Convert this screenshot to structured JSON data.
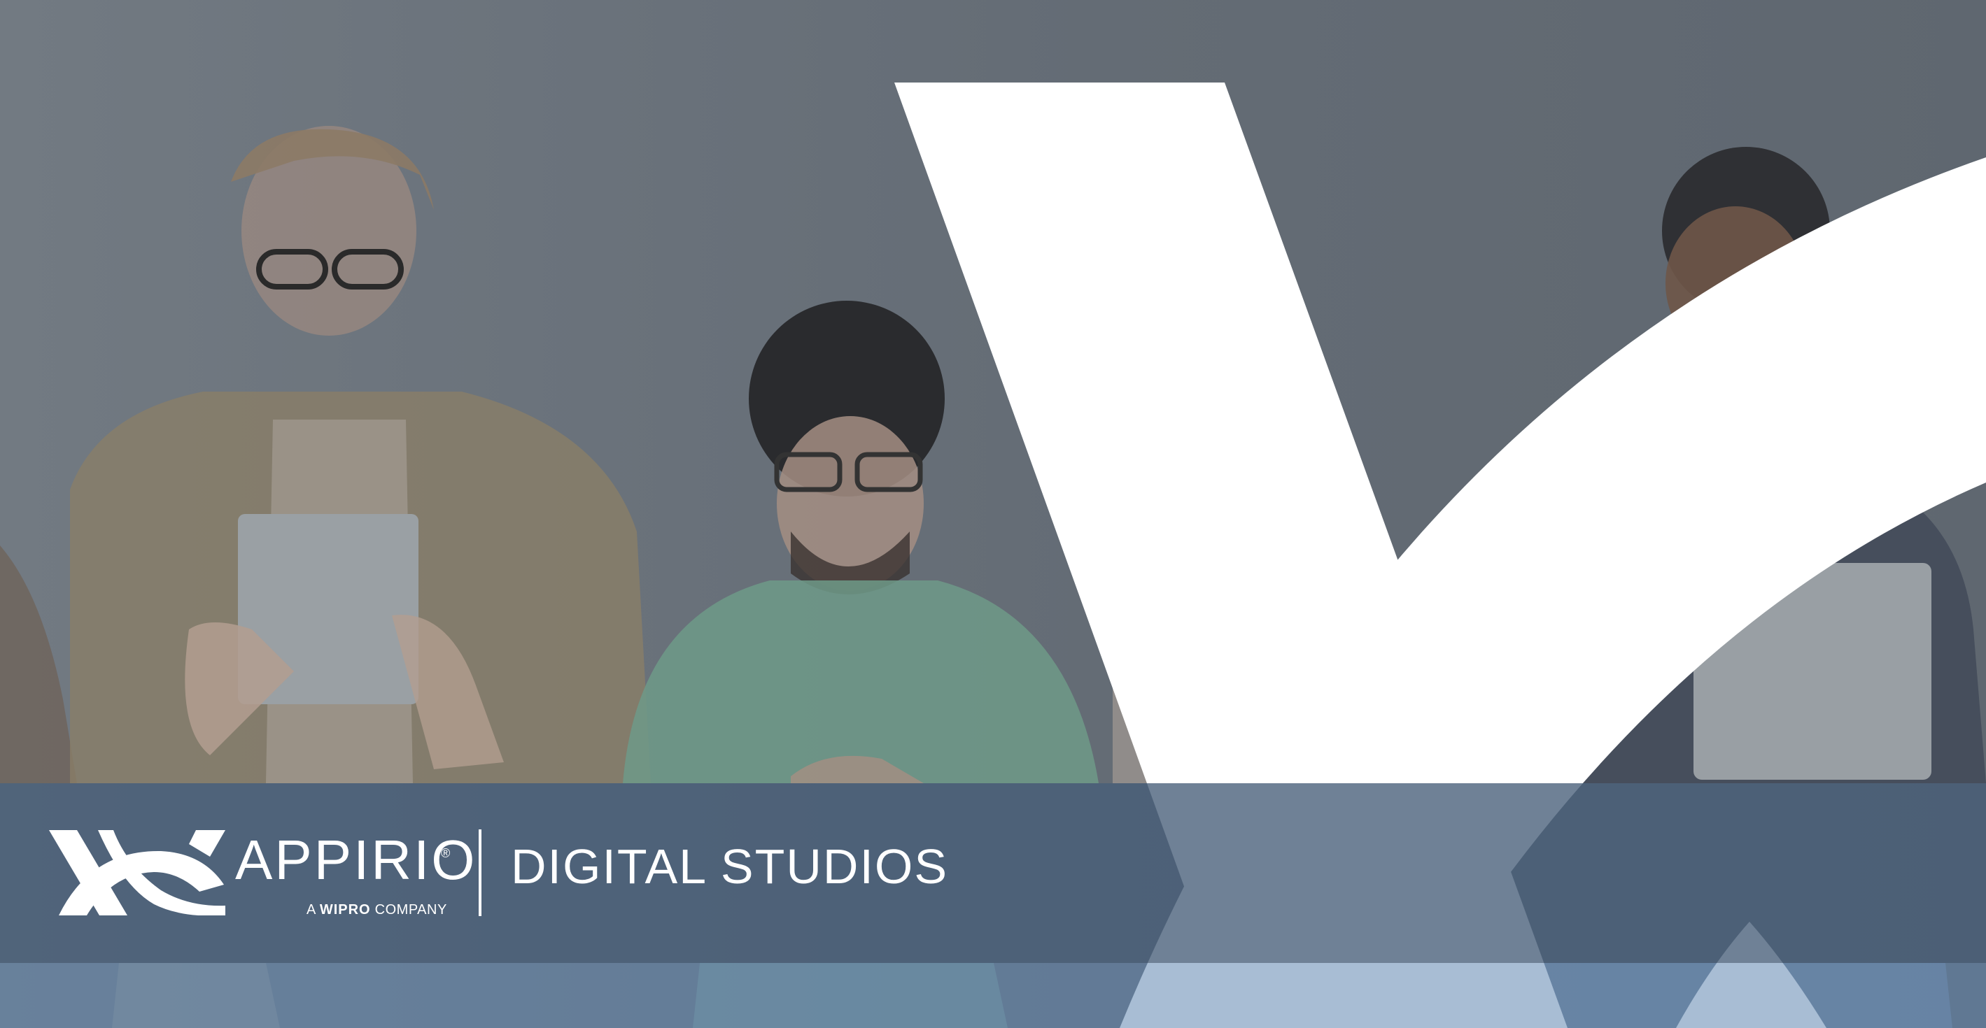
{
  "brand": {
    "name": "APPIRIO",
    "registered_mark": "®",
    "tagline_prefix": "A",
    "tagline_company": "WIPRO",
    "tagline_suffix": "COMPANY",
    "product": "DIGITAL STUDIOS"
  },
  "icons": {
    "logo": "appirio-x-logo-icon",
    "hero_graphic": "large-x-swoosh-icon"
  },
  "colors": {
    "background": "#5f6770",
    "band": "#465e78",
    "footer_strip": "#6086b0",
    "logo": "#ffffff"
  }
}
